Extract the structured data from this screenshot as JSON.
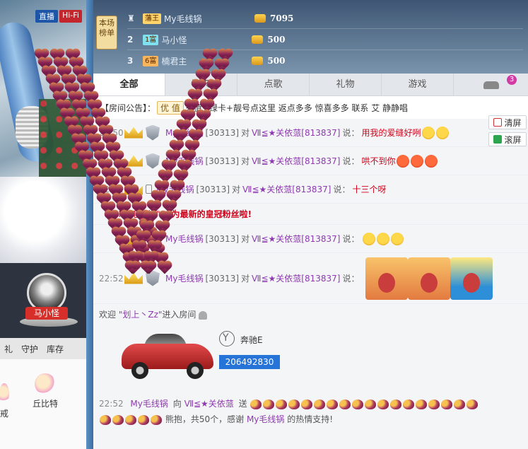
{
  "video": {
    "live_badge": "直播",
    "hifi_badge": "Hi-Fi"
  },
  "anchor": {
    "name": "马小怪"
  },
  "left_tabs": [
    "礼",
    "守护",
    "库存"
  ],
  "left_gifts": [
    {
      "label": "戒"
    },
    {
      "label": "丘比特"
    }
  ],
  "rank": {
    "label": "本场榜单",
    "rows": [
      {
        "num": "1",
        "tag": "藩王",
        "name": "My毛线锅",
        "amount": "7095"
      },
      {
        "num": "2",
        "tag": "1富",
        "name": "马小怪",
        "amount": "500"
      },
      {
        "num": "3",
        "tag": "6富",
        "name": "楠君主",
        "amount": "500"
      }
    ]
  },
  "tabs": [
    {
      "label": "全部",
      "active": true
    },
    {
      "label": "聊天"
    },
    {
      "label": "点歌"
    },
    {
      "label": "礼物"
    },
    {
      "label": "游戏"
    }
  ],
  "tab_car_count": "3",
  "notice": {
    "label": "【房间公告】：",
    "chip_left": "优",
    "chip_right": "值",
    "text": "充值+绿卡+靓号点这里 返点多多 惊喜多多 联系 艾 静静唱"
  },
  "messages": [
    {
      "time": "22:50",
      "user": "My毛线锅",
      "uid": "[30313]",
      "to": "对",
      "target": "Ⅶ≦★关依蒎[813837]",
      "say": "说：",
      "content": "用我的爱缝好咧"
    },
    {
      "time": "22:51",
      "user": "My毛线锅",
      "uid": "[30313]",
      "to": "对",
      "target": "Ⅶ≦★关依蒎[813837]",
      "say": "说：",
      "content": "哄不到你"
    },
    {
      "time": "22:51",
      "user": "My毛线锅",
      "uid": "[30313]",
      "to": "对",
      "target": "Ⅶ≦★关依蒎[813837]",
      "say": "说：",
      "content": "十三个呀"
    },
    {
      "time": "",
      "user": "My毛线锅",
      "uid": "[30313]",
      "to": "对",
      "target": "Ⅶ≦★关依蒎[813837]",
      "say": "说：",
      "content": ""
    },
    {
      "time": "22:52",
      "user": "My毛线锅",
      "uid": "[30313]",
      "to": "对",
      "target": "Ⅶ≦★关依蒎[813837]",
      "say": "说：",
      "content": ""
    }
  ],
  "system_msg": {
    "quote_name": "\"My毛线锅\"",
    "text": " 成为最新的皇冠粉丝啦!"
  },
  "side_buttons": {
    "clear": "清屏",
    "scroll": "滚屏"
  },
  "welcome": {
    "prefix": "欢迎",
    "name": "\"划上丶Zz\"",
    "suffix": "进入房间"
  },
  "car": {
    "name": "奔驰E",
    "number": "206492830"
  },
  "gift_msg": {
    "time": "22:52",
    "user": "My毛线锅",
    "action": "向",
    "target": "Ⅶ≦★关依蒎",
    "send": "送",
    "tail": "熊抱，共50个，感谢",
    "thanks_user": "My毛线锅",
    "thanks_end": "的热情支持!"
  }
}
